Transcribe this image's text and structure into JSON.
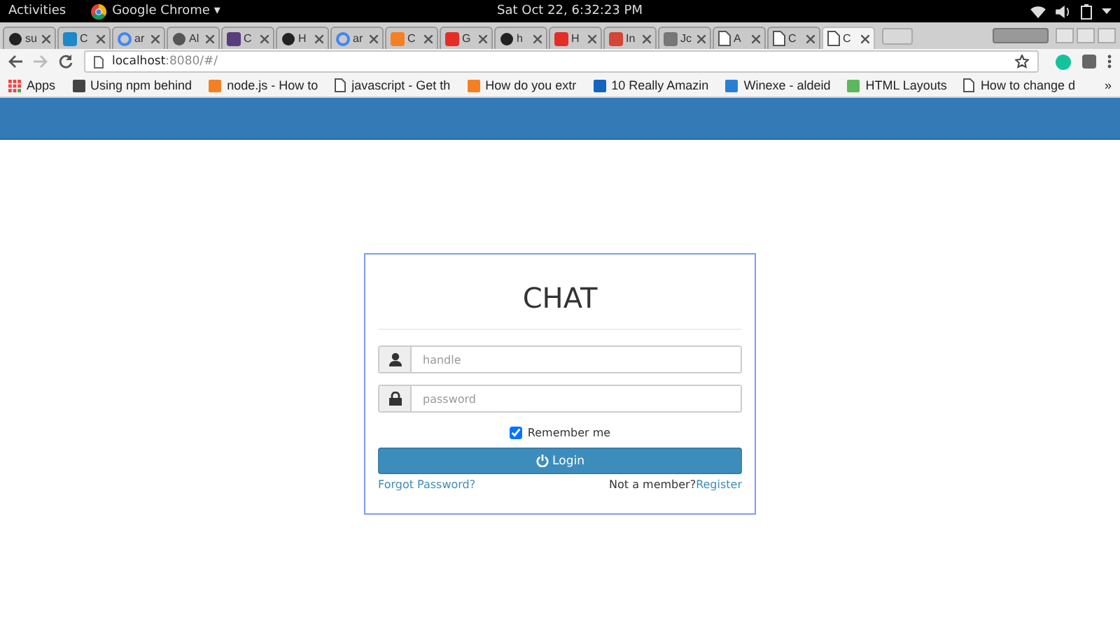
{
  "top_bar": {
    "activities": "Activities",
    "app": "Google Chrome",
    "app_menu": "▾",
    "clock": "Sat Oct 22,  6:32:23 PM"
  },
  "tabs": [
    {
      "label": "su",
      "kind": "github",
      "selected": false
    },
    {
      "label": "C",
      "kind": "square",
      "selected": false
    },
    {
      "label": "ar",
      "kind": "google",
      "selected": false
    },
    {
      "label": "Al",
      "kind": "gear",
      "selected": false
    },
    {
      "label": "C",
      "kind": "bootstrap",
      "selected": false
    },
    {
      "label": "H",
      "kind": "github",
      "selected": false
    },
    {
      "label": "ar",
      "kind": "google",
      "selected": false
    },
    {
      "label": "C",
      "kind": "stack",
      "selected": false
    },
    {
      "label": "G",
      "kind": "youtube",
      "selected": false
    },
    {
      "label": "h",
      "kind": "github",
      "selected": false
    },
    {
      "label": "H",
      "kind": "youtube",
      "selected": false
    },
    {
      "label": "In",
      "kind": "mail",
      "selected": false
    },
    {
      "label": "Jc",
      "kind": "hand",
      "selected": false
    },
    {
      "label": "A",
      "kind": "doc",
      "selected": false
    },
    {
      "label": "C",
      "kind": "doc",
      "selected": false
    },
    {
      "label": "C",
      "kind": "doc",
      "selected": true
    }
  ],
  "address": {
    "host": "localhost",
    "path": ":8080/#/"
  },
  "bookmarks": [
    {
      "label": "Apps",
      "kind": "apps"
    },
    {
      "label": "Using npm behind",
      "kind": "box"
    },
    {
      "label": "node.js - How to",
      "kind": "stack"
    },
    {
      "label": "javascript - Get th",
      "kind": "doc"
    },
    {
      "label": "How do you extr",
      "kind": "stack"
    },
    {
      "label": "10 Really Amazin",
      "kind": "p"
    },
    {
      "label": "Winexe - aldeid",
      "kind": "wave"
    },
    {
      "label": "HTML Layouts",
      "kind": "green"
    },
    {
      "label": "How to change d",
      "kind": "doc"
    }
  ],
  "bookmarks_more": "»",
  "login": {
    "title": "CHAT",
    "fields": [
      {
        "kind": "user",
        "placeholder": "handle"
      },
      {
        "kind": "lock",
        "placeholder": "password"
      }
    ],
    "remember": {
      "label": "Remember me",
      "checked": true
    },
    "button": "Login",
    "forgot": "Forgot Password?",
    "not_member": "Not a member?",
    "register": "Register"
  }
}
